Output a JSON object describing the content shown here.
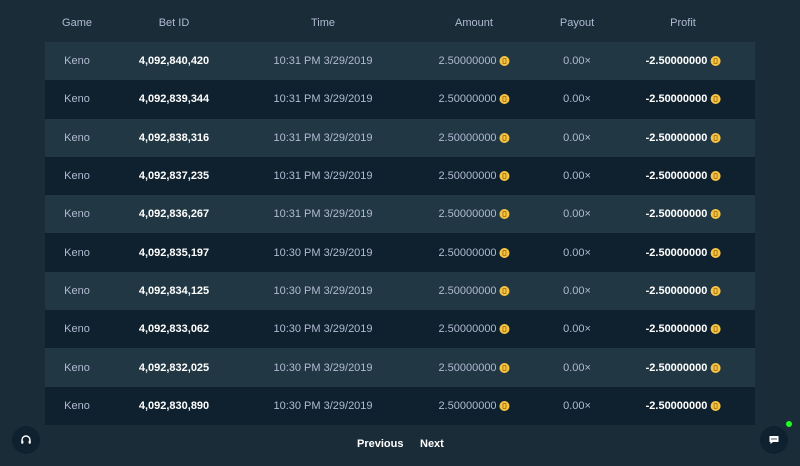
{
  "table": {
    "headers": {
      "game": "Game",
      "bet_id": "Bet ID",
      "time": "Time",
      "amount": "Amount",
      "payout": "Payout",
      "profit": "Profit"
    },
    "rows": [
      {
        "game": "Keno",
        "bet_id": "4,092,840,420",
        "time": "10:31 PM 3/29/2019",
        "amount": "2.50000000",
        "payout": "0.00×",
        "profit": "-2.50000000"
      },
      {
        "game": "Keno",
        "bet_id": "4,092,839,344",
        "time": "10:31 PM 3/29/2019",
        "amount": "2.50000000",
        "payout": "0.00×",
        "profit": "-2.50000000"
      },
      {
        "game": "Keno",
        "bet_id": "4,092,838,316",
        "time": "10:31 PM 3/29/2019",
        "amount": "2.50000000",
        "payout": "0.00×",
        "profit": "-2.50000000"
      },
      {
        "game": "Keno",
        "bet_id": "4,092,837,235",
        "time": "10:31 PM 3/29/2019",
        "amount": "2.50000000",
        "payout": "0.00×",
        "profit": "-2.50000000"
      },
      {
        "game": "Keno",
        "bet_id": "4,092,836,267",
        "time": "10:31 PM 3/29/2019",
        "amount": "2.50000000",
        "payout": "0.00×",
        "profit": "-2.50000000"
      },
      {
        "game": "Keno",
        "bet_id": "4,092,835,197",
        "time": "10:30 PM 3/29/2019",
        "amount": "2.50000000",
        "payout": "0.00×",
        "profit": "-2.50000000"
      },
      {
        "game": "Keno",
        "bet_id": "4,092,834,125",
        "time": "10:30 PM 3/29/2019",
        "amount": "2.50000000",
        "payout": "0.00×",
        "profit": "-2.50000000"
      },
      {
        "game": "Keno",
        "bet_id": "4,092,833,062",
        "time": "10:30 PM 3/29/2019",
        "amount": "2.50000000",
        "payout": "0.00×",
        "profit": "-2.50000000"
      },
      {
        "game": "Keno",
        "bet_id": "4,092,832,025",
        "time": "10:30 PM 3/29/2019",
        "amount": "2.50000000",
        "payout": "0.00×",
        "profit": "-2.50000000"
      },
      {
        "game": "Keno",
        "bet_id": "4,092,830,890",
        "time": "10:30 PM 3/29/2019",
        "amount": "2.50000000",
        "payout": "0.00×",
        "profit": "-2.50000000"
      }
    ]
  },
  "pagination": {
    "previous_label": "Previous",
    "next_label": "Next"
  },
  "icons": {
    "coin": "coin-icon",
    "support": "headset-icon",
    "chat": "chat-icon"
  },
  "colors": {
    "coin": "#f6c545",
    "online": "#1fff20"
  }
}
